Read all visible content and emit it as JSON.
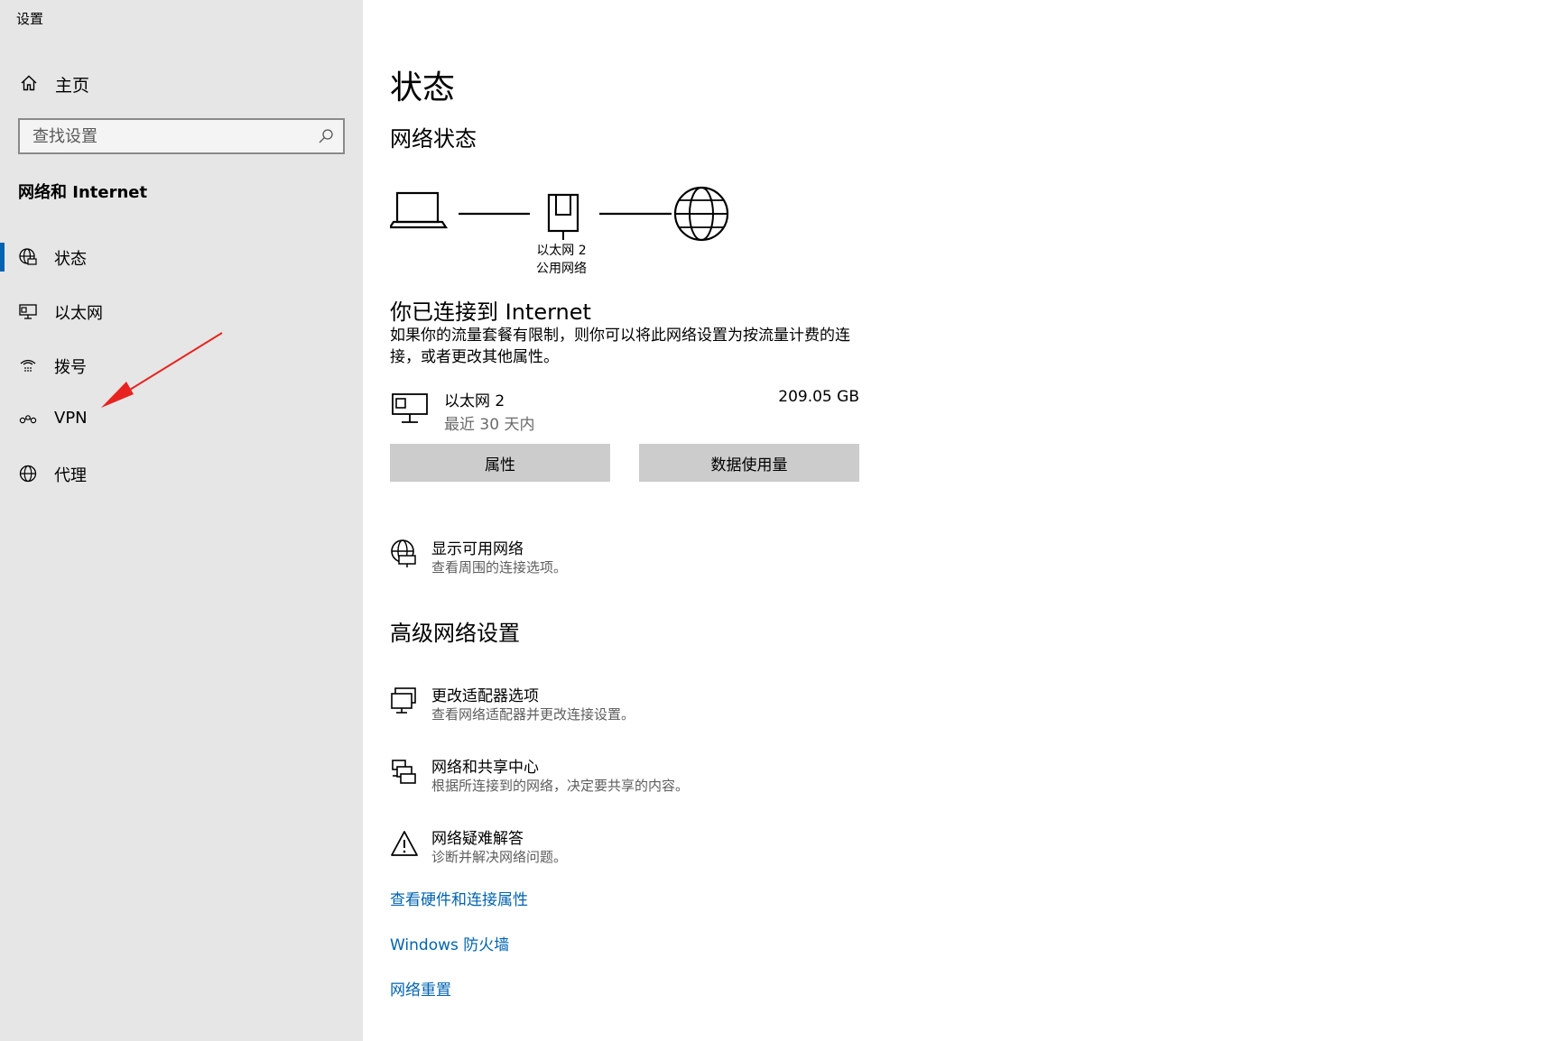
{
  "window": {
    "title": "设置"
  },
  "sidebar": {
    "home_label": "主页",
    "search_placeholder": "查找设置",
    "section_heading": "网络和 Internet",
    "items": [
      {
        "label": "状态",
        "icon": "status-globe-icon",
        "active": true
      },
      {
        "label": "以太网",
        "icon": "ethernet-icon",
        "active": false
      },
      {
        "label": "拨号",
        "icon": "dialup-icon",
        "active": false
      },
      {
        "label": "VPN",
        "icon": "vpn-icon",
        "active": false
      },
      {
        "label": "代理",
        "icon": "globe-icon",
        "active": false
      }
    ]
  },
  "main": {
    "page_title": "状态",
    "network_status_title": "网络状态",
    "diagram": {
      "network_name": "以太网 2",
      "network_type": "公用网络"
    },
    "connection": {
      "title": "你已连接到 Internet",
      "description": "如果你的流量套餐有限制，则你可以将此网络设置为按流量计费的连接，或者更改其他属性。"
    },
    "adapter": {
      "name": "以太网 2",
      "period": "最近 30 天内",
      "usage": "209.05 GB"
    },
    "buttons": {
      "properties": "属性",
      "data_usage": "数据使用量"
    },
    "show_networks": {
      "title": "显示可用网络",
      "desc": "查看周围的连接选项。"
    },
    "advanced_title": "高级网络设置",
    "advanced_items": [
      {
        "title": "更改适配器选项",
        "desc": "查看网络适配器并更改连接设置。",
        "icon": "adapter-monitor-icon"
      },
      {
        "title": "网络和共享中心",
        "desc": "根据所连接到的网络，决定要共享的内容。",
        "icon": "sharing-center-icon"
      },
      {
        "title": "网络疑难解答",
        "desc": "诊断并解决网络问题。",
        "icon": "warning-icon"
      }
    ],
    "links": [
      "查看硬件和连接属性",
      "Windows 防火墙",
      "网络重置"
    ]
  },
  "colors": {
    "sidebar_bg": "#e6e6e6",
    "accent": "#0063b1",
    "button_bg": "#cccccc",
    "annotation_arrow": "#e8231f"
  }
}
